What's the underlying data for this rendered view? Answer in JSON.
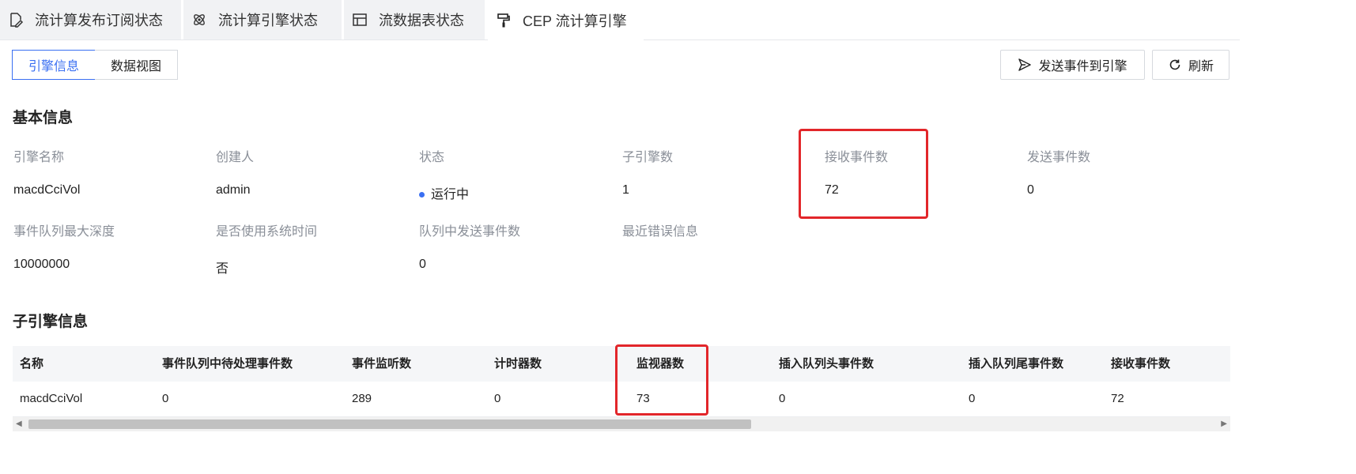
{
  "tabs": [
    {
      "label": "流计算发布订阅状态",
      "icon": "edit-doc-icon"
    },
    {
      "label": "流计算引擎状态",
      "icon": "atom-icon"
    },
    {
      "label": "流数据表状态",
      "icon": "table-icon"
    },
    {
      "label": "CEP 流计算引擎",
      "icon": "paint-roller-icon",
      "active": true
    }
  ],
  "toggle": {
    "engine_info": "引擎信息",
    "data_view": "数据视图"
  },
  "actions": {
    "send_event": "发送事件到引擎",
    "refresh": "刷新"
  },
  "basic": {
    "title": "基本信息",
    "fields": [
      {
        "label": "引擎名称",
        "value": "macdCciVol"
      },
      {
        "label": "创建人",
        "value": "admin"
      },
      {
        "label": "状态",
        "value": "运行中"
      },
      {
        "label": "子引擎数",
        "value": "1"
      },
      {
        "label": "接收事件数",
        "value": "72"
      },
      {
        "label": "发送事件数",
        "value": "0"
      },
      {
        "label": "事件队列最大深度",
        "value": "10000000"
      },
      {
        "label": "是否使用系统时间",
        "value": "否"
      },
      {
        "label": "队列中发送事件数",
        "value": "0"
      },
      {
        "label": "最近错误信息",
        "value": ""
      }
    ]
  },
  "sub": {
    "title": "子引擎信息",
    "columns": [
      "名称",
      "事件队列中待处理事件数",
      "事件监听数",
      "计时器数",
      "监视器数",
      "插入队列头事件数",
      "插入队列尾事件数",
      "接收事件数"
    ],
    "rows": [
      [
        "macdCciVol",
        "0",
        "289",
        "0",
        "73",
        "0",
        "0",
        "72"
      ]
    ]
  },
  "colors": {
    "accent": "#3a6ff2",
    "highlight": "#e2262a"
  }
}
